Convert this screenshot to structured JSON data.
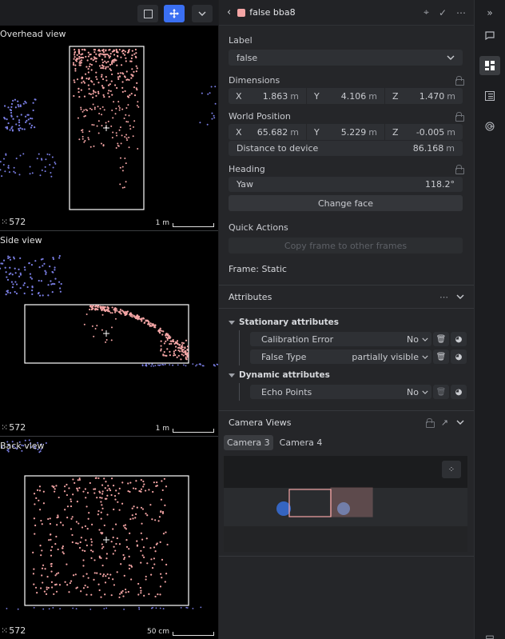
{
  "views": {
    "overhead": {
      "title": "Overhead view",
      "count": "572",
      "scale": "1 m"
    },
    "side": {
      "title": "Side view",
      "count": "572",
      "scale": "1 m"
    },
    "back": {
      "title": "Back view",
      "count": "572",
      "scale": "50 cm"
    }
  },
  "toolbar": {
    "icons": [
      "select-box-icon",
      "move-icon",
      "chevron-down-icon"
    ]
  },
  "panel": {
    "header": {
      "title": "false bba8",
      "swatch_color": "#f4a5a5"
    },
    "label": {
      "heading": "Label",
      "value": "false"
    },
    "dimensions": {
      "heading": "Dimensions",
      "x": {
        "axis": "X",
        "value": "1.863",
        "unit": "m"
      },
      "y": {
        "axis": "Y",
        "value": "4.106",
        "unit": "m"
      },
      "z": {
        "axis": "Z",
        "value": "1.470",
        "unit": "m"
      }
    },
    "world_position": {
      "heading": "World Position",
      "x": {
        "axis": "X",
        "value": "65.682",
        "unit": "m"
      },
      "y": {
        "axis": "Y",
        "value": "5.229",
        "unit": "m"
      },
      "z": {
        "axis": "Z",
        "value": "-0.005",
        "unit": "m"
      },
      "distance_label": "Distance to device",
      "distance_value": "86.168",
      "distance_unit": "m"
    },
    "heading": {
      "heading": "Heading",
      "yaw_label": "Yaw",
      "yaw_value": "118.2°",
      "change_face": "Change face"
    },
    "quick_actions": {
      "heading": "Quick Actions",
      "copy_frame": "Copy frame to other frames"
    },
    "frame": "Frame: Static",
    "attributes": {
      "heading": "Attributes",
      "stationary": {
        "heading": "Stationary attributes",
        "items": [
          {
            "label": "Calibration Error",
            "value": "No"
          },
          {
            "label": "False Type",
            "value": "partially visible"
          }
        ]
      },
      "dynamic": {
        "heading": "Dynamic attributes",
        "items": [
          {
            "label": "Echo Points",
            "value": "No"
          }
        ]
      }
    },
    "camera": {
      "heading": "Camera Views",
      "tabs": [
        "Camera 3",
        "Camera 4"
      ]
    }
  },
  "colors": {
    "accent": "#3a6ff2",
    "object_points": "#f4a5a5",
    "other_points": "#7b7fe6"
  }
}
